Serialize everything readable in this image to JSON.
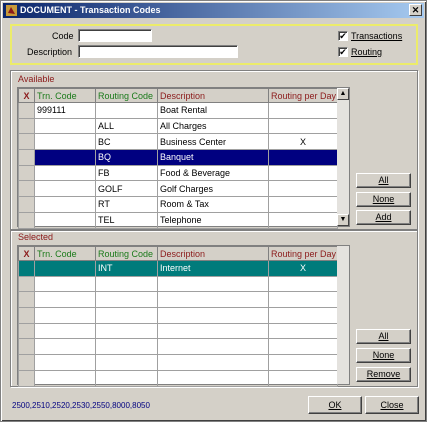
{
  "window": {
    "title": "DOCUMENT - Transaction Codes",
    "close_glyph": "✕"
  },
  "filter": {
    "code_label": "Code",
    "code_value": "",
    "description_label": "Description",
    "description_value": "",
    "transactions": {
      "label": "Transactions",
      "checked": true
    },
    "routing": {
      "label": "Routing",
      "checked": true
    }
  },
  "available": {
    "label": "Available",
    "columns": {
      "x": "X",
      "trn": "Trn. Code",
      "routing": "Routing Code",
      "description": "Description",
      "rpd": "Routing per Day"
    },
    "rows": [
      {
        "trn": "999111",
        "routing": "",
        "description": "Boat Rental",
        "rpd": ""
      },
      {
        "trn": "",
        "routing": "ALL",
        "description": "All Charges",
        "rpd": ""
      },
      {
        "trn": "",
        "routing": "BC",
        "description": "Business Center",
        "rpd": "X"
      },
      {
        "trn": "",
        "routing": "BQ",
        "description": "Banquet",
        "rpd": ""
      },
      {
        "trn": "",
        "routing": "FB",
        "description": "Food & Beverage",
        "rpd": ""
      },
      {
        "trn": "",
        "routing": "GOLF",
        "description": "Golf Charges",
        "rpd": ""
      },
      {
        "trn": "",
        "routing": "RT",
        "description": "Room & Tax",
        "rpd": ""
      },
      {
        "trn": "",
        "routing": "TEL",
        "description": "Telephone",
        "rpd": ""
      }
    ],
    "buttons": {
      "all": "All",
      "none": "None",
      "add": "Add"
    }
  },
  "selected": {
    "label": "Selected",
    "columns": {
      "x": "X",
      "trn": "Trn. Code",
      "routing": "Routing Code",
      "description": "Description",
      "rpd": "Routing per Day"
    },
    "rows": [
      {
        "trn": "",
        "routing": "INT",
        "description": "Internet",
        "rpd": "X"
      },
      {
        "trn": "",
        "routing": "",
        "description": "",
        "rpd": ""
      },
      {
        "trn": "",
        "routing": "",
        "description": "",
        "rpd": ""
      },
      {
        "trn": "",
        "routing": "",
        "description": "",
        "rpd": ""
      },
      {
        "trn": "",
        "routing": "",
        "description": "",
        "rpd": ""
      },
      {
        "trn": "",
        "routing": "",
        "description": "",
        "rpd": ""
      },
      {
        "trn": "",
        "routing": "",
        "description": "",
        "rpd": ""
      },
      {
        "trn": "",
        "routing": "",
        "description": "",
        "rpd": ""
      }
    ],
    "buttons": {
      "all": "All",
      "none": "None",
      "remove": "Remove"
    }
  },
  "status_text": "2500,2510,2520,2530,2550,8000,8050",
  "footer": {
    "ok": "OK",
    "close": "Close"
  },
  "icons": {
    "app": "opera-app-icon",
    "scroll_up": "arrow-up-icon",
    "scroll_down": "arrow-down-icon"
  },
  "colors": {
    "title_start": "#0a246a",
    "title_end": "#a6caf0",
    "selection": "#000080",
    "selected_row": "#007b7b",
    "filter_border": "#ecec6a"
  }
}
